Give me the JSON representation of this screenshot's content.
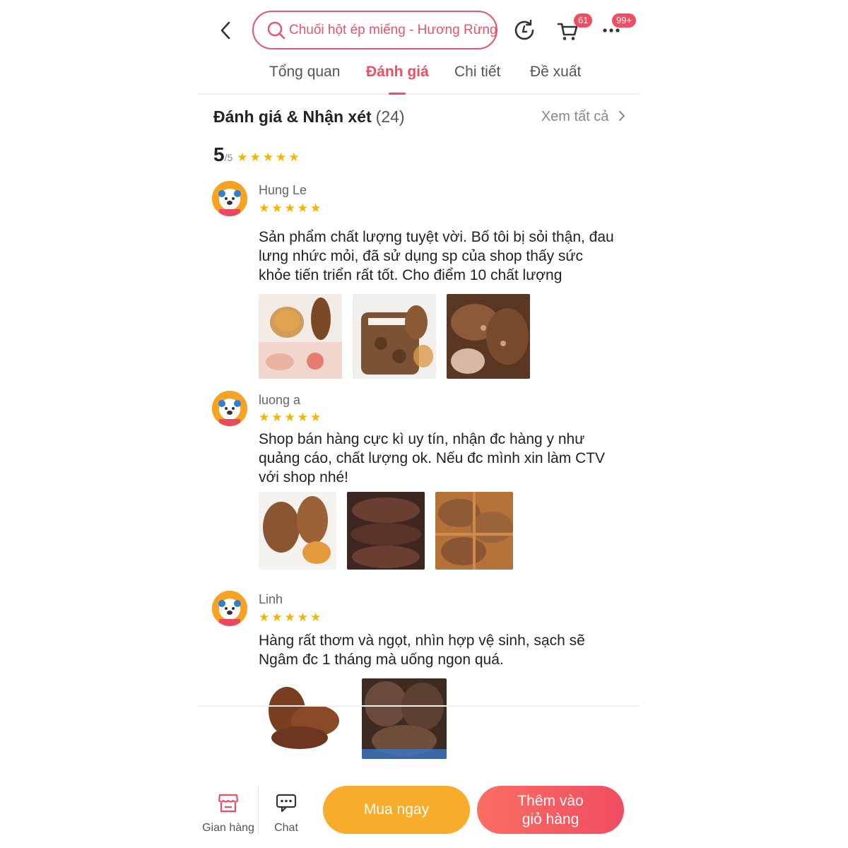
{
  "header": {
    "search_placeholder": "Chuối hột ép miếng -  Hương Rừng",
    "cart_badge": "61",
    "more_badge": "99+"
  },
  "tabs": [
    {
      "label": "Tổng quan",
      "active": false
    },
    {
      "label": "Đánh giá",
      "active": true
    },
    {
      "label": "Chi tiết",
      "active": false
    },
    {
      "label": "Đề xuất",
      "active": false
    }
  ],
  "reviews_section": {
    "title": "Đánh giá & Nhận xét",
    "count": "(24)",
    "see_all": "Xem tất cả",
    "score": "5",
    "score_out_of": "/5",
    "stars": "★★★★★",
    "star_rating": 5
  },
  "reviews": [
    {
      "name": "Hung Le",
      "stars": "★★★★★",
      "rating": 5,
      "text": "Sản phẩm chất lượng tuyệt vời. Bố tôi bị sỏi thận, đau lưng nhức mỏi, đã sử dụng sp của shop thấy sức khỏe tiến triển rất tốt. Cho điểm 10 chất lượng",
      "photos": [
        "banana-slices-tea-kidney-photo",
        "packaged-dried-banana-photo",
        "banana-slices-in-hand-photo"
      ]
    },
    {
      "name": "luong a",
      "stars": "★★★★★",
      "rating": 5,
      "text": "Shop bán hàng cực kì uy tín, nhận đc hàng y như quảng cáo, chất lượng ok. Nếu đc mình xin làm CTV với shop nhé!",
      "photos": [
        "banana-slices-with-tea-photo",
        "dark-banana-slices-photo",
        "banana-slices-on-rack-photo"
      ]
    },
    {
      "name": "Linh",
      "stars": "★★★★★",
      "rating": 5,
      "text": "Hàng rất thơm và ngọt,  nhìn hợp vệ sinh, sạch sẽ Ngâm đc 1 tháng mà uống ngon quá.",
      "photos": [
        "pile-of-banana-slices-photo",
        "banana-slices-closeup-photo"
      ]
    }
  ],
  "bottom_bar": {
    "store_label": "Gian hàng",
    "chat_label": "Chat",
    "buy_now": "Mua ngay",
    "add_to_cart_line1": "Thêm vào",
    "add_to_cart_line2": "giỏ hàng"
  },
  "colors": {
    "accent": "#f04d62",
    "star": "#f5b400",
    "buy_now": "#f7ac2c"
  }
}
